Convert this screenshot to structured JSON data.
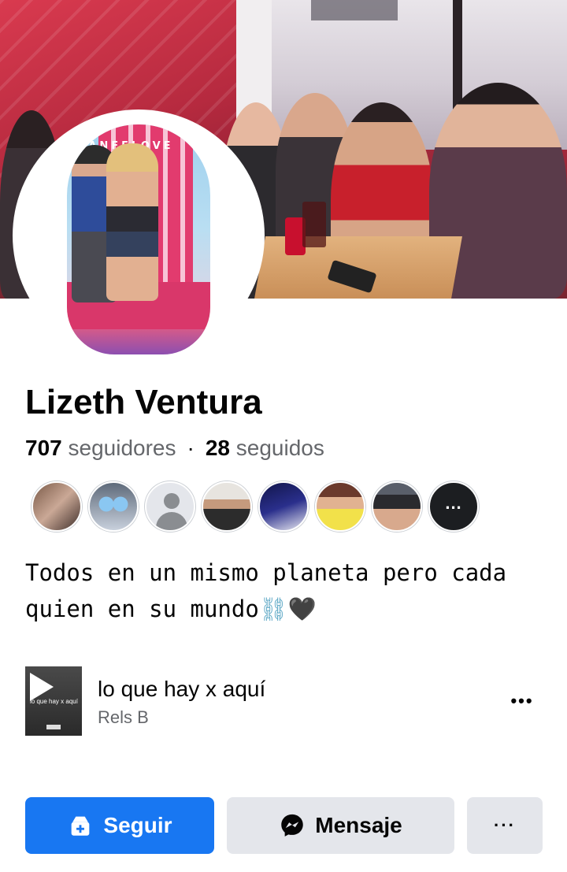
{
  "profile": {
    "name": "Lizeth Ventura",
    "followers_count": "707",
    "followers_label": "seguidores",
    "separator": "·",
    "following_count": "28",
    "following_label": "seguidos",
    "bio_text": "Todos en un mismo planeta pero cada quien en su mundo",
    "bio_emojis": [
      "⛓",
      "🖤"
    ]
  },
  "cover": {
    "description_icon": "cover-photo"
  },
  "avatar": {
    "chair_text": "SANFELOVE"
  },
  "friends": {
    "items": [
      {
        "name": "friend-avatar-1"
      },
      {
        "name": "friend-avatar-2"
      },
      {
        "name": "friend-avatar-3"
      },
      {
        "name": "friend-avatar-4"
      },
      {
        "name": "friend-avatar-5"
      },
      {
        "name": "friend-avatar-6"
      },
      {
        "name": "friend-avatar-7"
      }
    ],
    "more_label": "..."
  },
  "music": {
    "title": "lo que hay x aquí",
    "artist": "Rels B",
    "thumb_text": "lo que hay x aquí",
    "more_label": "•••"
  },
  "actions": {
    "follow_label": "Seguir",
    "message_label": "Mensaje",
    "more_label": "···"
  },
  "colors": {
    "primary": "#1877f2",
    "secondary_bg": "#e4e6eb",
    "text_primary": "#050505",
    "text_secondary": "#65676b"
  }
}
